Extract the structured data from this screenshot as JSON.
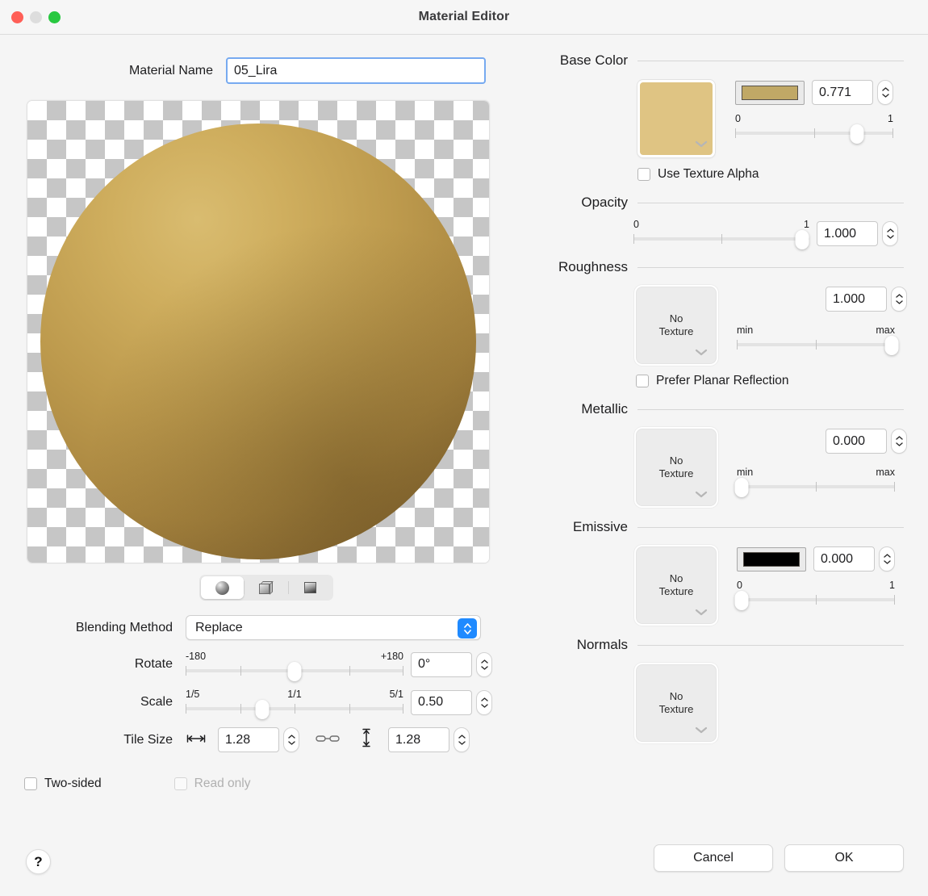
{
  "window": {
    "title": "Material Editor",
    "traffic_lights": [
      "close",
      "minimize",
      "zoom"
    ]
  },
  "material_name": {
    "label": "Material Name",
    "value": "05_Lira"
  },
  "preview": {
    "shape_modes": [
      "sphere",
      "cube",
      "plane"
    ],
    "selected_shape": "sphere",
    "sphere_color": "#bd9a4d",
    "checker_color": "#c6c6c6"
  },
  "blending": {
    "label": "Blending Method",
    "value": "Replace"
  },
  "rotate": {
    "label": "Rotate",
    "min_cap": "-180",
    "max_cap": "+180",
    "value": "0°",
    "thumb_pct": 50
  },
  "scale": {
    "label": "Scale",
    "min_cap": "1/5",
    "mid_cap": "1/1",
    "max_cap": "5/1",
    "value": "0.50",
    "thumb_pct": 35
  },
  "tile_size": {
    "label": "Tile Size",
    "width_value": "1.28",
    "height_value": "1.28",
    "linked": true
  },
  "toggles": {
    "two_sided": {
      "label": "Two-sided",
      "checked": false,
      "disabled": false
    },
    "read_only": {
      "label": "Read only",
      "checked": false,
      "disabled": true
    }
  },
  "help": {
    "glyph": "?"
  },
  "sections": {
    "base_color": {
      "title": "Base Color",
      "texture_color": "#dfc483",
      "color_well": "#c0a866",
      "value": "0.771",
      "min_cap": "0",
      "max_cap": "1",
      "thumb_pct": 77,
      "checkbox": {
        "label": "Use Texture Alpha",
        "checked": false
      }
    },
    "opacity": {
      "title": "Opacity",
      "value": "1.000",
      "min_cap": "0",
      "max_cap": "1",
      "thumb_pct": 96
    },
    "roughness": {
      "title": "Roughness",
      "texture_label_line1": "No",
      "texture_label_line2": "Texture",
      "value": "1.000",
      "min_cap": "min",
      "max_cap": "max",
      "thumb_pct": 98,
      "checkbox": {
        "label": "Prefer Planar Reflection",
        "checked": false
      }
    },
    "metallic": {
      "title": "Metallic",
      "texture_label_line1": "No",
      "texture_label_line2": "Texture",
      "value": "0.000",
      "min_cap": "min",
      "max_cap": "max",
      "thumb_pct": 2
    },
    "emissive": {
      "title": "Emissive",
      "texture_label_line1": "No",
      "texture_label_line2": "Texture",
      "color_well": "#000000",
      "value": "0.000",
      "min_cap": "0",
      "max_cap": "1",
      "thumb_pct": 2
    },
    "normals": {
      "title": "Normals",
      "texture_label_line1": "No",
      "texture_label_line2": "Texture"
    }
  },
  "buttons": {
    "cancel": "Cancel",
    "ok": "OK"
  }
}
